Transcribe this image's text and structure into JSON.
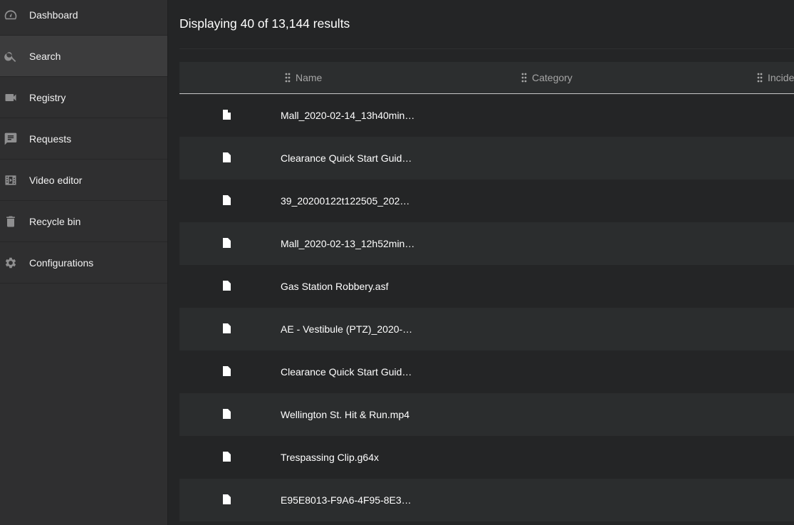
{
  "sidebar": {
    "items": [
      {
        "label": "Dashboard",
        "icon": "dashboard-icon"
      },
      {
        "label": "Search",
        "icon": "search-icon",
        "active": true
      },
      {
        "label": "Registry",
        "icon": "video-camera-icon"
      },
      {
        "label": "Requests",
        "icon": "request-icon"
      },
      {
        "label": "Video editor",
        "icon": "video-editor-icon"
      },
      {
        "label": "Recycle bin",
        "icon": "trash-icon"
      },
      {
        "label": "Configurations",
        "icon": "gear-icon"
      }
    ]
  },
  "main": {
    "results_title": "Displaying 40 of 13,144 results",
    "table": {
      "columns": [
        "Name",
        "Category",
        "Incide"
      ],
      "rows": [
        "Mall_2020-02-14_13h40min…",
        "Clearance Quick Start Guid…",
        "39_20200122t122505_202…",
        "Mall_2020-02-13_12h52min…",
        "Gas Station Robbery.asf",
        "AE - Vestibule (PTZ)_2020-…",
        "Clearance Quick Start Guid…",
        "Wellington St. Hit & Run.mp4",
        "Trespassing Clip.g64x",
        "E95E8013-F9A6-4F95-8E3B…"
      ]
    }
  },
  "colors": {
    "sidebar_bg": "#2f2f30",
    "sidebar_active": "#3c3c3d",
    "main_bg": "#242526",
    "row_alt": "#2b2d2e",
    "header_text": "#a6a6a6"
  }
}
